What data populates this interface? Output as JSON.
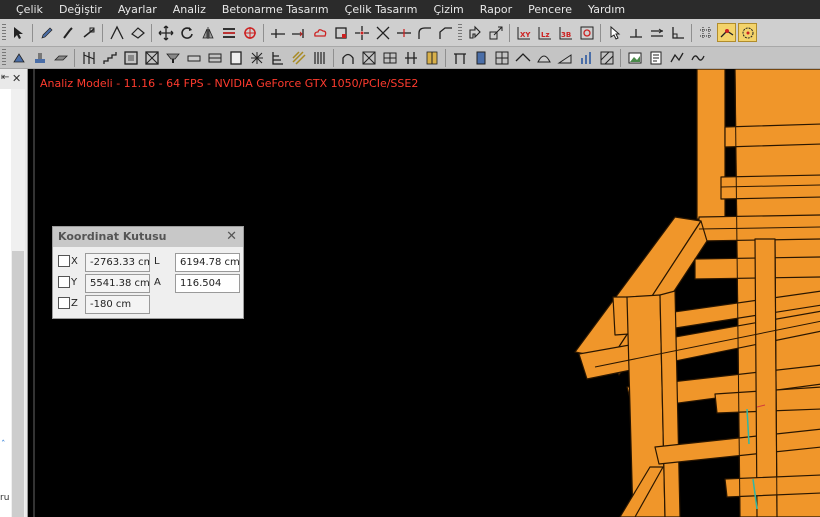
{
  "menu": [
    {
      "id": "celik",
      "label": "Çelik"
    },
    {
      "id": "degistir",
      "label": "Değiştir"
    },
    {
      "id": "ayarlar",
      "label": "Ayarlar"
    },
    {
      "id": "analiz",
      "label": "Analiz"
    },
    {
      "id": "betonarme-tasarim",
      "label": "Betonarme Tasarım"
    },
    {
      "id": "celik-tasarim",
      "label": "Çelik Tasarım"
    },
    {
      "id": "cizim",
      "label": "Çizim"
    },
    {
      "id": "rapor",
      "label": "Rapor"
    },
    {
      "id": "pencere",
      "label": "Pencere"
    },
    {
      "id": "yardim",
      "label": "Yardım"
    }
  ],
  "toolbar1": {
    "text_icons": {
      "xy": "XY",
      "lz": "Lz",
      "threed": "3B"
    }
  },
  "left_panel": {
    "pin_glyph": "⇤",
    "close_glyph": "✕",
    "partial_text": "ru",
    "mark": "ˆ"
  },
  "viewport": {
    "status_text": "Analiz Modeli - 11.16 -  64 FPS - NVIDIA GeForce GTX 1050/PCIe/SSE2",
    "status_color": "#ff3b2e",
    "member_color": "#f0962a"
  },
  "coordinate_box": {
    "title": "Koordinat Kutusu",
    "close_glyph": "✕",
    "x_label": "X",
    "y_label": "Y",
    "z_label": "Z",
    "l_label": "L",
    "a_label": "A",
    "x_value": "-2763.33 cm",
    "y_value": "5541.38 cm",
    "z_value": "-180 cm",
    "l_value": "6194.78 cm",
    "a_value": "116.504"
  }
}
